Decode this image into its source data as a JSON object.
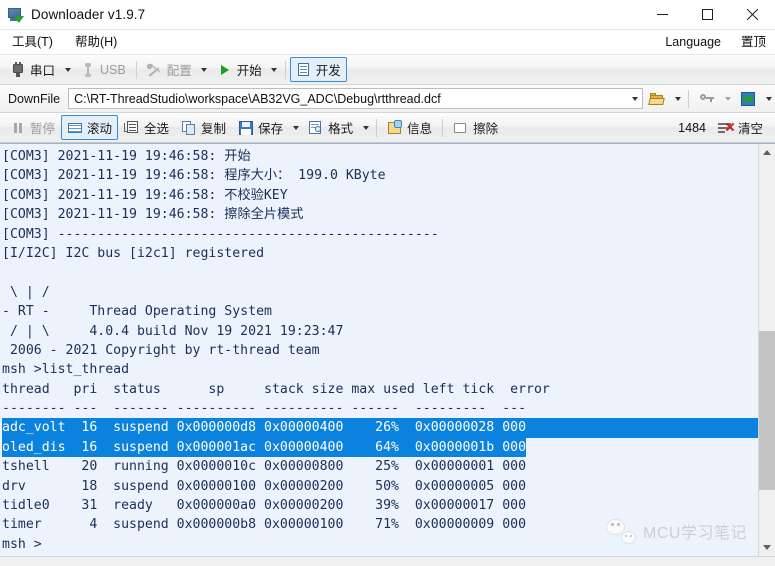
{
  "window": {
    "title": "Downloader v1.9.7",
    "icon": "app-monitor-icon",
    "minimize_label": "─",
    "maximize_label": "□",
    "close_label": "✕"
  },
  "menubar": {
    "items": [
      {
        "label": "工具(T)",
        "name": "menu-tools"
      },
      {
        "label": "帮助(H)",
        "name": "menu-help"
      }
    ],
    "right_items": [
      {
        "label": "Language",
        "name": "menu-language"
      },
      {
        "label": "置顶",
        "name": "menu-always-on-top"
      }
    ]
  },
  "toolbar_main": {
    "serial_label": "串口",
    "usb_label": "USB",
    "config_label": "配置",
    "start_label": "开始",
    "develop_label": "开发"
  },
  "downfile": {
    "label": "DownFile",
    "path": "C:\\RT-ThreadStudio\\workspace\\AB32VG_ADC\\Debug\\rtthread.dcf",
    "browse_icon": "folder-open-icon",
    "key_icon": "key-icon",
    "download_icon": "download-arrow-icon"
  },
  "toolbar_log": {
    "pause_label": "暂停",
    "scroll_label": "滚动",
    "select_all_label": "全选",
    "copy_label": "复制",
    "save_label": "保存",
    "format_label": "格式",
    "info_label": "信息",
    "erase_label": "擦除",
    "count": "1484",
    "clear_label": "清空"
  },
  "terminal": {
    "lines": [
      {
        "text": "[COM3] 2021-11-19 19:46:58: 开始",
        "selected": false
      },
      {
        "text": "[COM3] 2021-11-19 19:46:58: 程序大小： 199.0 KByte",
        "selected": false
      },
      {
        "text": "[COM3] 2021-11-19 19:46:58: 不校验KEY",
        "selected": false
      },
      {
        "text": "[COM3] 2021-11-19 19:46:58: 擦除全片模式",
        "selected": false
      },
      {
        "text": "[COM3] ------------------------------------------------",
        "selected": false
      },
      {
        "text": "[I/I2C] I2C bus [i2c1] registered",
        "selected": false
      },
      {
        "text": "",
        "selected": false
      },
      {
        "text": " \\ | /",
        "selected": false
      },
      {
        "text": "- RT -     Thread Operating System",
        "selected": false
      },
      {
        "text": " / | \\     4.0.4 build Nov 19 2021 19:23:47",
        "selected": false
      },
      {
        "text": " 2006 - 2021 Copyright by rt-thread team",
        "selected": false
      },
      {
        "text": "msh >list_thread",
        "selected": false
      },
      {
        "text": "thread   pri  status      sp     stack size max used left tick  error",
        "selected": false
      },
      {
        "text": "-------- ---  ------- ---------- ---------- ------  ---------  ---",
        "selected": false
      },
      {
        "text": "adc_volt  16  suspend 0x000000d8 0x00000400    26%  0x00000028 000",
        "selected": true,
        "full_width": true
      },
      {
        "text": "oled_dis  16  suspend 0x000001ac 0x00000400    64%  0x0000001b 000",
        "selected": true,
        "full_width": false
      },
      {
        "text": "tshell    20  running 0x0000010c 0x00000800    25%  0x00000001 000",
        "selected": false
      },
      {
        "text": "drv       18  suspend 0x00000100 0x00000200    50%  0x00000005 000",
        "selected": false
      },
      {
        "text": "tidle0    31  ready   0x000000a0 0x00000200    39%  0x00000017 000",
        "selected": false
      },
      {
        "text": "timer      4  suspend 0x000000b8 0x00000100    71%  0x00000009 000",
        "selected": false
      },
      {
        "text": "msh >",
        "selected": false
      }
    ]
  },
  "thread_table": {
    "headers": [
      "thread",
      "pri",
      "status",
      "sp",
      "stack size",
      "max used",
      "left tick",
      "error"
    ],
    "rows": [
      {
        "thread": "adc_volt",
        "pri": "16",
        "status": "suspend",
        "sp": "0x000000d8",
        "stack_size": "0x00000400",
        "max_used": "26%",
        "left_tick": "0x00000028",
        "error": "000",
        "selected": true
      },
      {
        "thread": "oled_dis",
        "pri": "16",
        "status": "suspend",
        "sp": "0x000001ac",
        "stack_size": "0x00000400",
        "max_used": "64%",
        "left_tick": "0x0000001b",
        "error": "000",
        "selected": true
      },
      {
        "thread": "tshell",
        "pri": "20",
        "status": "running",
        "sp": "0x0000010c",
        "stack_size": "0x00000800",
        "max_used": "25%",
        "left_tick": "0x00000001",
        "error": "000",
        "selected": false
      },
      {
        "thread": "drv",
        "pri": "18",
        "status": "suspend",
        "sp": "0x00000100",
        "stack_size": "0x00000200",
        "max_used": "50%",
        "left_tick": "0x00000005",
        "error": "000",
        "selected": false
      },
      {
        "thread": "tidle0",
        "pri": "31",
        "status": "ready",
        "sp": "0x000000a0",
        "stack_size": "0x00000200",
        "max_used": "39%",
        "left_tick": "0x00000017",
        "error": "000",
        "selected": false
      },
      {
        "thread": "timer",
        "pri": "4",
        "status": "suspend",
        "sp": "0x000000b8",
        "stack_size": "0x00000100",
        "max_used": "71%",
        "left_tick": "0x00000009",
        "error": "000",
        "selected": false
      }
    ]
  },
  "watermark": {
    "text": "MCU学习笔记",
    "icon": "wechat-logo-icon"
  },
  "colors": {
    "selection": "#0b82de",
    "terminal_bg": "#edf3fd",
    "terminal_fg": "#1a2e57",
    "accent_border": "#3d8ad4"
  }
}
